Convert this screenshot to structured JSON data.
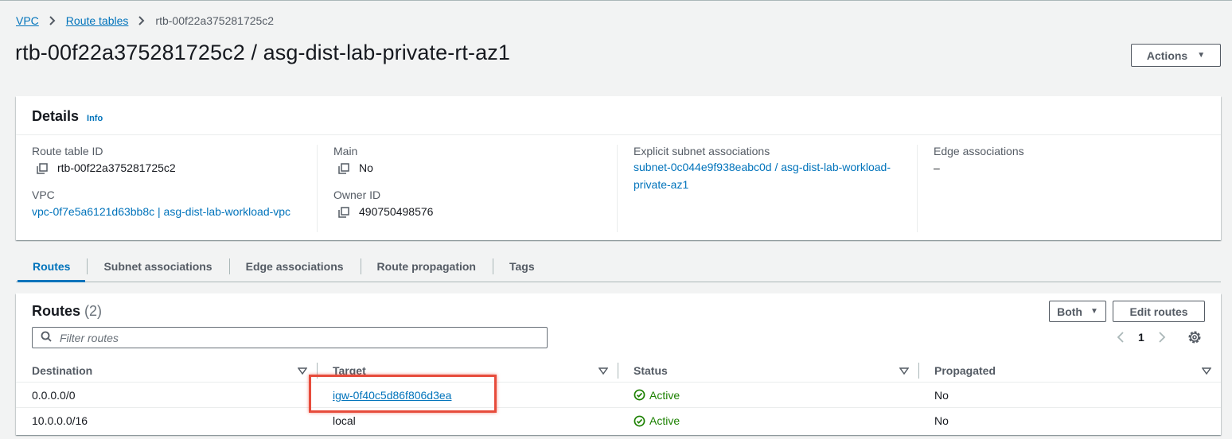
{
  "breadcrumb": {
    "items": [
      "VPC",
      "Route tables"
    ],
    "current": "rtb-00f22a375281725c2"
  },
  "page_title": "rtb-00f22a375281725c2 / asg-dist-lab-private-rt-az1",
  "actions_label": "Actions",
  "details": {
    "title": "Details",
    "info": "Info",
    "route_table_id_label": "Route table ID",
    "route_table_id": "rtb-00f22a375281725c2",
    "vpc_label": "VPC",
    "vpc": "vpc-0f7e5a6121d63bb8c | asg-dist-lab-workload-vpc",
    "main_label": "Main",
    "main": "No",
    "owner_label": "Owner ID",
    "owner": "490750498576",
    "explicit_label": "Explicit subnet associations",
    "explicit_line1": "subnet-0c044e9f938eabc0d / asg-dist-lab-workload-",
    "explicit_line2": "private-az1",
    "edge_label": "Edge associations",
    "edge": "–"
  },
  "tabs": [
    "Routes",
    "Subnet associations",
    "Edge associations",
    "Route propagation",
    "Tags"
  ],
  "active_tab": "Routes",
  "routes": {
    "title": "Routes",
    "count": "(2)",
    "both_label": "Both",
    "edit_label": "Edit routes",
    "filter_placeholder": "Filter routes",
    "page": "1",
    "columns": [
      "Destination",
      "Target",
      "Status",
      "Propagated"
    ],
    "rows": [
      {
        "destination": "0.0.0.0/0",
        "target": "igw-0f40c5d86f806d3ea",
        "status": "Active",
        "propagated": "No"
      },
      {
        "destination": "10.0.0.0/16",
        "target": "local",
        "status": "Active",
        "propagated": "No"
      }
    ]
  },
  "colors": {
    "link": "#0073bb",
    "success": "#1d8102",
    "highlight": "#e74c3c"
  }
}
